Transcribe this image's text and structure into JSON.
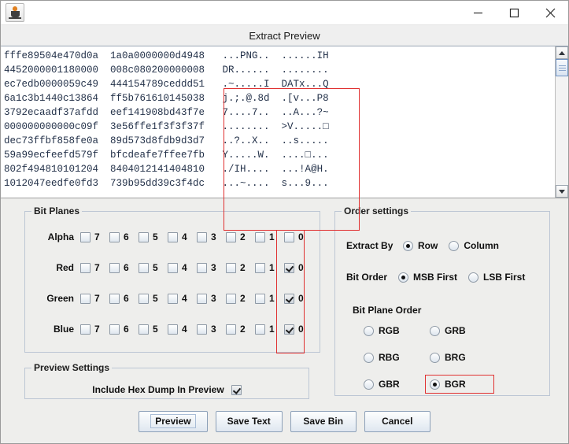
{
  "window": {
    "app_icon": "java-coffee-cup-icon",
    "minimize_label": "–",
    "maximize_label": "□",
    "close_label": "✕",
    "caption": "Extract Preview"
  },
  "preview": {
    "hex_lines": [
      "fffe89504e470d0a  1a0a0000000d4948",
      "4452000001180000  008c080200000008",
      "ec7edb0000059c49  444154789ceddd51",
      "6a1c3b1440c13864  ff5b761610145038",
      "3792ecaadf37afdd  eef141908bd43f7e",
      "000000000000c09f  3e56ffe1f3f3f37f",
      "dec73ffbf858fe0a  89d573d8fdb9d3d7",
      "59a99ecfeefd579f  bfcdeafe7ffee7fb",
      "802f494810101204  8404012141404810",
      "1012047eedfe0fd3  739b95dd39c3f4dc"
    ],
    "ascii_lines": [
      "...PNG..  ......IH",
      "DR......  ........",
      ".~.....I  DATx...Q",
      "j.;.@.8d  .[v...P8",
      "7....7..  ..A...?~",
      "........  >V.....□",
      "..?..X..  ..s.....",
      "Y.....W.  ....□...",
      "./IH....  ...!A@H.",
      "...~....  s...9..."
    ],
    "scrollbar": {
      "up_icon": "scroll-up-arrow-icon",
      "down_icon": "scroll-down-arrow-icon"
    }
  },
  "bit_planes": {
    "title": "Bit Planes",
    "bit_labels": [
      "7",
      "6",
      "5",
      "4",
      "3",
      "2",
      "1",
      "0"
    ],
    "rows": [
      {
        "label": "Alpha",
        "checked": [
          false,
          false,
          false,
          false,
          false,
          false,
          false,
          false
        ]
      },
      {
        "label": "Red",
        "checked": [
          false,
          false,
          false,
          false,
          false,
          false,
          false,
          true
        ]
      },
      {
        "label": "Green",
        "checked": [
          false,
          false,
          false,
          false,
          false,
          false,
          false,
          true
        ]
      },
      {
        "label": "Blue",
        "checked": [
          false,
          false,
          false,
          false,
          false,
          false,
          false,
          true
        ]
      }
    ],
    "highlight_color": "#e03030"
  },
  "order_settings": {
    "title": "Order settings",
    "extract_by": {
      "label": "Extract By",
      "options": [
        "Row",
        "Column"
      ],
      "selected": "Row"
    },
    "bit_order": {
      "label": "Bit Order",
      "options": [
        "MSB First",
        "LSB First"
      ],
      "selected": "MSB First"
    },
    "bit_plane_order": {
      "label": "Bit Plane Order",
      "options": [
        "RGB",
        "GRB",
        "RBG",
        "BRG",
        "GBR",
        "BGR"
      ],
      "selected": "BGR"
    }
  },
  "preview_settings": {
    "title": "Preview Settings",
    "include_hex_dump": {
      "label": "Include Hex Dump In Preview",
      "checked": true
    }
  },
  "buttons": {
    "preview": "Preview",
    "save_text": "Save Text",
    "save_bin": "Save Bin",
    "cancel": "Cancel"
  }
}
